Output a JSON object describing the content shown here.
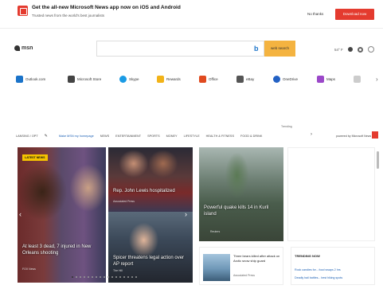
{
  "promo": {
    "title": "Get the all-new Microsoft News app now on iOS and Android",
    "subtitle": "Trusted news from the world's best journalists",
    "no_thanks": "No thanks",
    "download": "Download now"
  },
  "header": {
    "logo": "msn",
    "web_search": "web search",
    "weather": "54° F"
  },
  "quicklinks": [
    {
      "label": "Outlook.com",
      "color": "#1a73c9"
    },
    {
      "label": "Microsoft Store",
      "color": "#444444"
    },
    {
      "label": "Skype",
      "color": "#1a9be5"
    },
    {
      "label": "Rewards",
      "color": "#f2b318"
    },
    {
      "label": "Office",
      "color": "#e04a1f"
    },
    {
      "label": "eBay",
      "color": "#555555"
    },
    {
      "label": "OneDrive",
      "color": "#2361c4"
    },
    {
      "label": "Maps",
      "color": "#9b48c9"
    }
  ],
  "nav": {
    "location": "LANSING / OPT",
    "make_home": "Make MSN my homepage",
    "items": [
      "NEWS",
      "ENTERTAINMENT",
      "SPORTS",
      "MONEY",
      "LIFESTYLE",
      "HEALTH & FITNESS",
      "FOOD & DRINK"
    ],
    "trending_label": "Trending",
    "powered": "powered by Microsoft News"
  },
  "hero": {
    "left": {
      "badge": "LATEST NEWS",
      "caption": "At least 3 dead, 7 injured in New Orleans shooting",
      "source": "FOX News"
    },
    "top_right": {
      "caption": "Rep. John Lewis hospitalized",
      "source": "Associated Press"
    },
    "bottom_right": {
      "caption": "Spicer threatens legal action over AP report",
      "source": "The Hill"
    }
  },
  "cards": {
    "mid": {
      "caption": "Powerful quake kills 14 in Kuril island",
      "source": "Reuters"
    },
    "small": {
      "title": "Three bears killed after attack on Arctic snow ship guard",
      "source": "Associated Press"
    },
    "trending_now": {
      "header": "TRENDING NOW",
      "row1": "Rock candies for... food swaps 2 hrs",
      "row2": "Deadly hail battles... best hiking spots"
    }
  }
}
